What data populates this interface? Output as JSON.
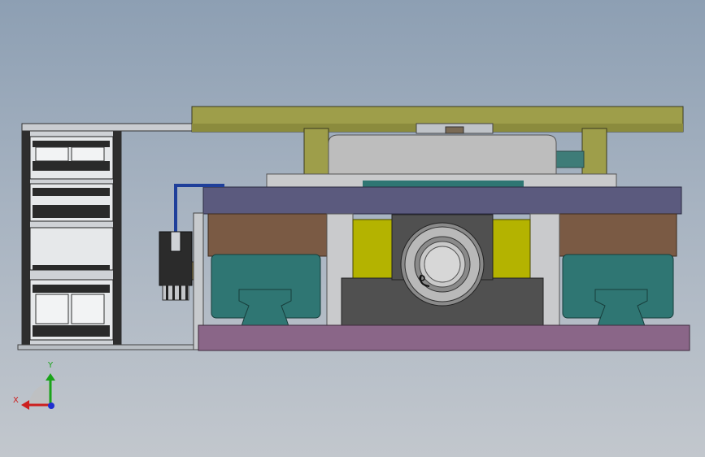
{
  "model_parts": [
    {
      "name": "top-mounting-plate",
      "color": "#9e9e4a"
    },
    {
      "name": "bearing-housing",
      "color": "#bdbdbd"
    },
    {
      "name": "carriage-plate",
      "color": "#5b5a7e"
    },
    {
      "name": "slider-block",
      "color": "#7a5a44"
    },
    {
      "name": "guide-rail-block",
      "color": "#2f7673"
    },
    {
      "name": "bearing-seat",
      "color": "#b4b300"
    },
    {
      "name": "base-plate",
      "color": "#8a6688"
    },
    {
      "name": "cable-chain",
      "color": "#404040"
    },
    {
      "name": "sensor-connector",
      "color": "#2b2b2b"
    },
    {
      "name": "sensor-cable",
      "color": "#1f3f9a"
    },
    {
      "name": "bracket",
      "color": "#7d8c82"
    }
  ],
  "triad": {
    "y_label": "Y",
    "x_label": "X",
    "y_color": "#1aa31a",
    "x_color": "#cc1f1f",
    "z_color": "#1f2fd0"
  }
}
